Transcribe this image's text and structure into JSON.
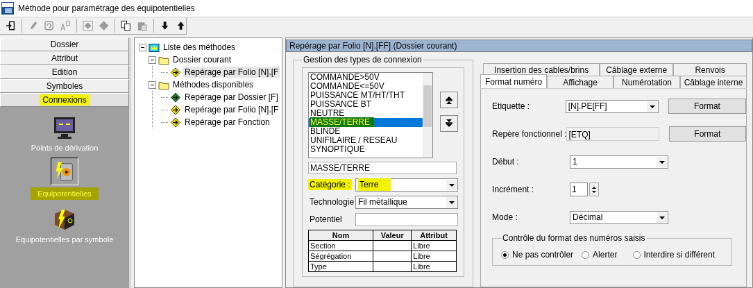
{
  "window": {
    "title": "Méthode pour paramétrage des équipotentielles"
  },
  "toolbar": [
    {
      "kind": "exit",
      "disabled": false
    },
    {
      "kind": "pencil",
      "disabled": true
    },
    {
      "kind": "refresh",
      "disabled": true
    },
    {
      "kind": "font",
      "disabled": true
    },
    {
      "kind": "diamond-box",
      "disabled": true
    },
    {
      "kind": "diamond",
      "disabled": true
    },
    {
      "kind": "copy",
      "disabled": false
    },
    {
      "kind": "paste",
      "disabled": true
    },
    {
      "kind": "down",
      "disabled": false
    },
    {
      "kind": "up",
      "disabled": false
    }
  ],
  "sidebar": {
    "sections": [
      {
        "label": "Dossier",
        "selected": false,
        "highlighted": false
      },
      {
        "label": "Attribut",
        "selected": false,
        "highlighted": false
      },
      {
        "label": "Edition",
        "selected": false,
        "highlighted": false
      },
      {
        "label": "Symboles",
        "selected": false,
        "highlighted": false
      },
      {
        "label": "Connexions",
        "selected": true,
        "highlighted": true
      }
    ],
    "items": [
      {
        "label": "Points de dérivation",
        "kind": "monitor",
        "selected": false,
        "highlighted": false
      },
      {
        "label": "Equipotentielles",
        "kind": "barrel",
        "selected": true,
        "highlighted": true
      },
      {
        "label": "Equipotentielles par symbole",
        "kind": "box",
        "selected": false,
        "highlighted": false
      }
    ]
  },
  "tree": [
    {
      "label": "Liste des méthodes",
      "expanded": true,
      "selected": false,
      "children": [
        {
          "label": "Dossier courant",
          "expanded": true,
          "selected": false,
          "children": [
            {
              "label": "Repérage par Folio [N].[F",
              "color": "#f2e600",
              "selected": true
            }
          ]
        },
        {
          "label": "Méthodes disponibles",
          "expanded": true,
          "selected": false,
          "children": [
            {
              "label": "Repérage par Dossier [F]",
              "color": "#1c8a2c",
              "selected": false
            },
            {
              "label": "Repérage par Folio [N].[F",
              "color": "#f2e600",
              "selected": false
            },
            {
              "label": "Repérage par Fonction",
              "color": "#f2e600",
              "selected": false
            }
          ]
        }
      ]
    }
  ],
  "panel": {
    "header": "Repérage par Folio [N].[FF] (Dossier courant)",
    "connection_types": {
      "title": "Gestion des types de connexion",
      "list": [
        {
          "label": "COMMANDE>50V",
          "selected": false,
          "highlighted": false
        },
        {
          "label": "COMMANDE<=50V",
          "selected": false,
          "highlighted": false
        },
        {
          "label": "PUISSANCE MT/HT/THT",
          "selected": false,
          "highlighted": false
        },
        {
          "label": "PUISSANCE BT",
          "selected": false,
          "highlighted": false
        },
        {
          "label": "NEUTRE",
          "selected": false,
          "highlighted": false
        },
        {
          "label": "MASSE/TERRE",
          "selected": true,
          "highlighted": true
        },
        {
          "label": "BLINDE",
          "selected": false,
          "highlighted": false
        },
        {
          "label": "UNIFILAIRE / RESEAU",
          "selected": false,
          "highlighted": false
        },
        {
          "label": "SYNOPTIQUE",
          "selected": false,
          "highlighted": false
        }
      ],
      "name_value": "MASSE/TERRE",
      "fields": [
        {
          "label": "Catégorie :",
          "kind": "dropdown",
          "value": "Terre",
          "highlighted": true
        },
        {
          "label": "Technologie",
          "kind": "dropdown",
          "value": "Fil métallique",
          "highlighted": false
        },
        {
          "label": "Potentiel",
          "kind": "text",
          "highlighted": false
        }
      ],
      "table": {
        "columns": [
          "Nom",
          "Valeur",
          "Attribut"
        ],
        "rows": [
          [
            "Section",
            "",
            "Libre"
          ],
          [
            "Ségrégation",
            "",
            "Libre"
          ],
          [
            "Type",
            "",
            "Libre"
          ]
        ]
      }
    },
    "tabs": [
      [
        {
          "label": "Insertion des cables/brins",
          "selected": false
        },
        {
          "label": "Câblage externe",
          "selected": false
        },
        {
          "label": "Renvois",
          "selected": false
        }
      ],
      [
        {
          "label": "Format numéro",
          "selected": true
        },
        {
          "label": "Affichage",
          "selected": false
        },
        {
          "label": "Numérotation",
          "selected": false
        },
        {
          "label": "Câblage interne",
          "selected": false
        }
      ]
    ],
    "form": [
      {
        "label": "Etiquette :",
        "kind": "dropdown",
        "value": "[N].PE[FF]",
        "button": "Format"
      },
      {
        "label": "Repère fonctionnel :",
        "kind": "readonly",
        "value": "[ETQ]",
        "button": "Format"
      },
      {
        "label": "Début :",
        "kind": "dropdown",
        "value": "1"
      },
      {
        "label": "Incrément :",
        "kind": "spinner",
        "value": "1"
      },
      {
        "label": "Mode :",
        "kind": "dropdown",
        "value": "Décimal"
      }
    ],
    "format_check": {
      "title": "Contrôle du format des numéros saisis",
      "options": [
        {
          "label": "Ne pas contrôler",
          "selected": true
        },
        {
          "label": "Alerter",
          "selected": false
        },
        {
          "label": "Interdire si différent",
          "selected": false
        }
      ]
    }
  }
}
